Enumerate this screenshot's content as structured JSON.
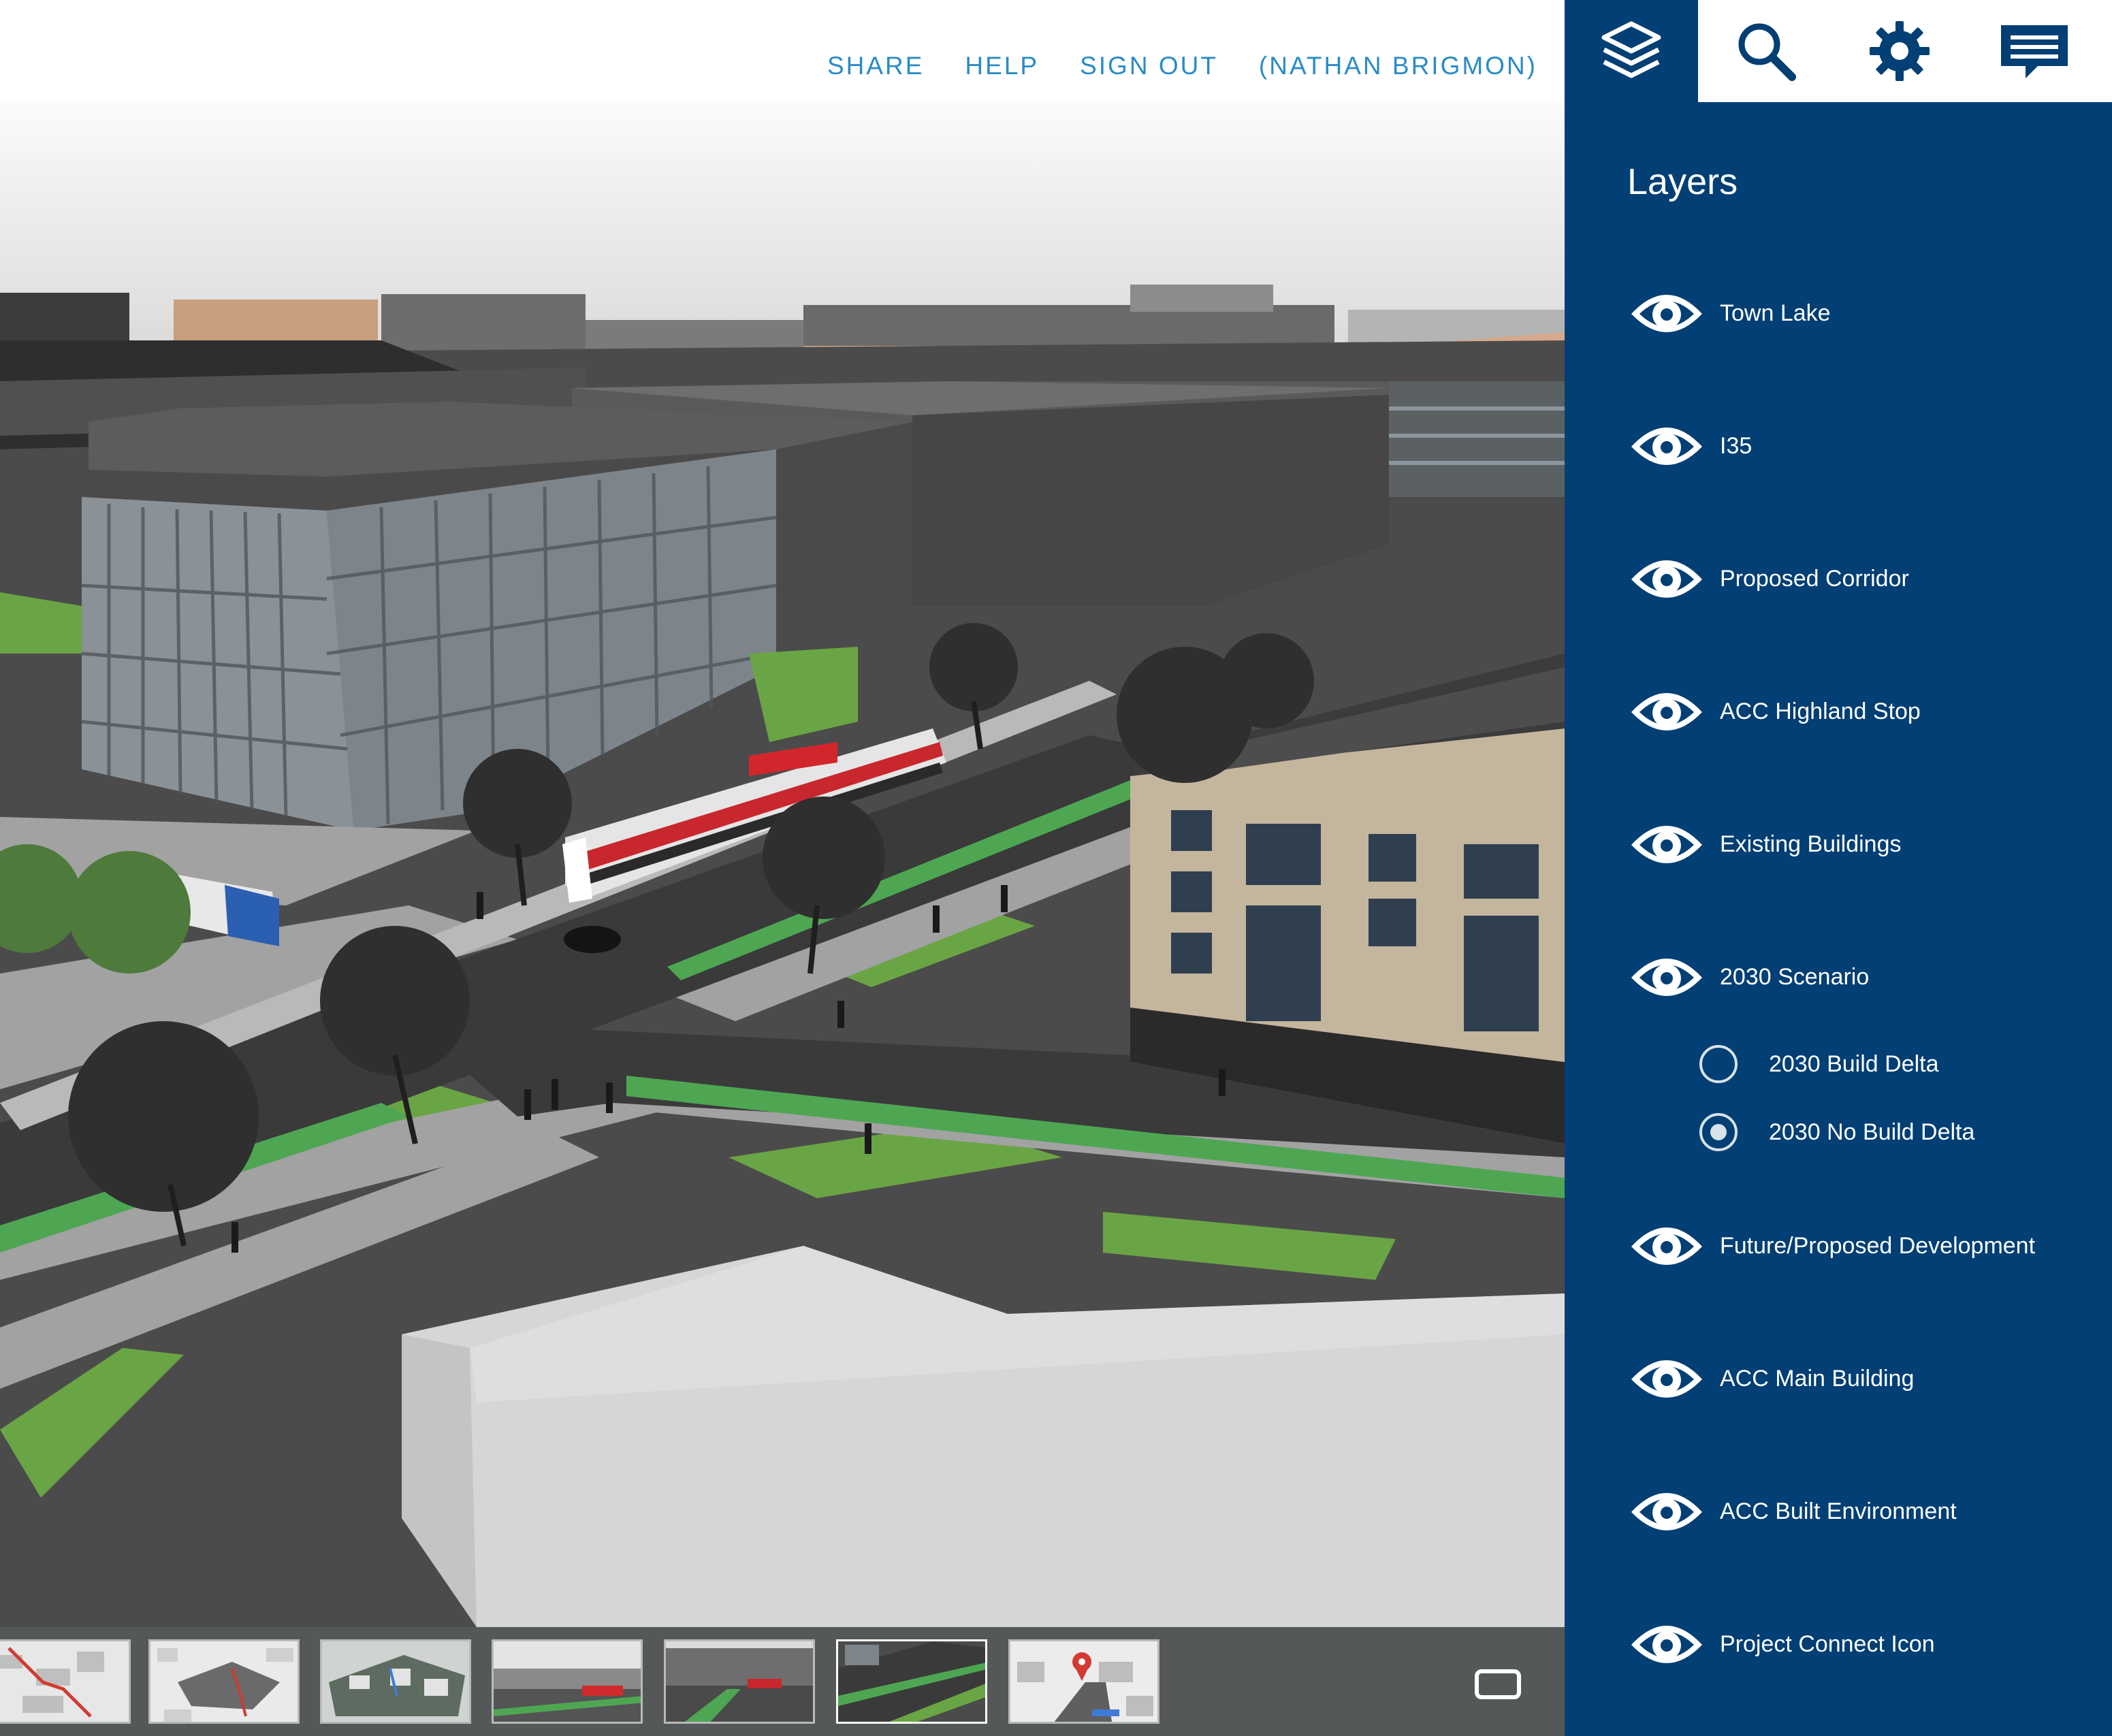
{
  "header": {
    "nav": [
      {
        "id": "share",
        "label": "SHARE"
      },
      {
        "id": "help",
        "label": "HELP"
      },
      {
        "id": "signout",
        "label": "SIGN OUT"
      },
      {
        "id": "user",
        "label": "(NATHAN BRIGMON)"
      }
    ]
  },
  "toolbar": {
    "tools": [
      "layers-icon",
      "search-icon",
      "gear-icon",
      "chat-icon"
    ],
    "active": "layers-icon"
  },
  "panel": {
    "title": "Layers",
    "layers": [
      {
        "label": "Town Lake"
      },
      {
        "label": "I35"
      },
      {
        "label": "Proposed Corridor"
      },
      {
        "label": "ACC Highland Stop"
      },
      {
        "label": "Existing Buildings"
      },
      {
        "label": "2030 Scenario"
      },
      {
        "label": "Future/Proposed Development"
      },
      {
        "label": "ACC Main Building"
      },
      {
        "label": "ACC Built Environment"
      },
      {
        "label": "Project Connect Icon"
      }
    ],
    "scenario_options": [
      {
        "label": "2030 Build Delta",
        "selected": false
      },
      {
        "label": "2030 No Build Delta",
        "selected": true
      }
    ]
  },
  "thumbnails": {
    "count": 7,
    "active_index": 5
  },
  "colors": {
    "panel_bg": "#023f74",
    "nav_link": "#2a8bc6",
    "thumb_strip_bg": "#555859"
  }
}
